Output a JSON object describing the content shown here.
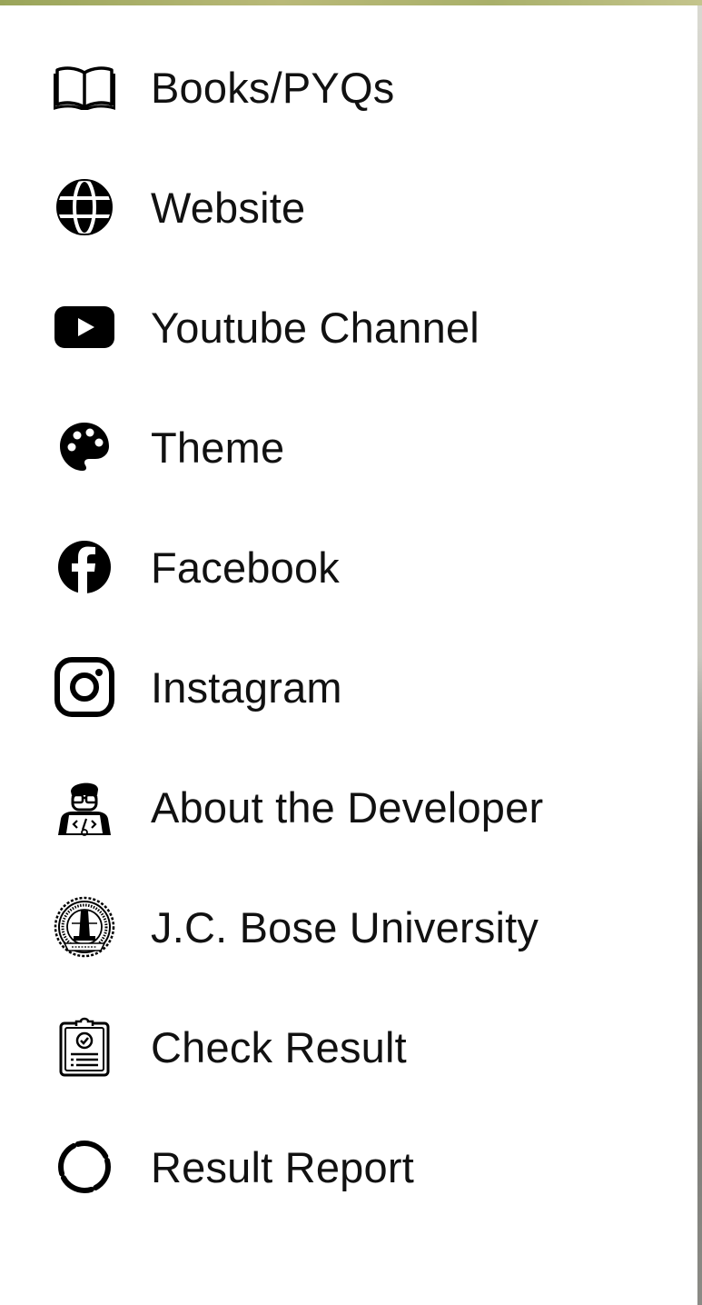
{
  "menu": {
    "items": [
      {
        "label": "Books/PYQs",
        "icon": "book-icon"
      },
      {
        "label": "Website",
        "icon": "globe-icon"
      },
      {
        "label": "Youtube Channel",
        "icon": "youtube-icon"
      },
      {
        "label": "Theme",
        "icon": "palette-icon"
      },
      {
        "label": "Facebook",
        "icon": "facebook-icon"
      },
      {
        "label": "Instagram",
        "icon": "instagram-icon"
      },
      {
        "label": "About the Developer",
        "icon": "developer-icon"
      },
      {
        "label": "J.C. Bose University",
        "icon": "university-seal-icon"
      },
      {
        "label": "Check Result",
        "icon": "clipboard-check-icon"
      },
      {
        "label": "Result Report",
        "icon": "circle-progress-icon"
      }
    ]
  },
  "colors": {
    "text": "#111111",
    "icon": "#000000",
    "background": "#ffffff"
  }
}
